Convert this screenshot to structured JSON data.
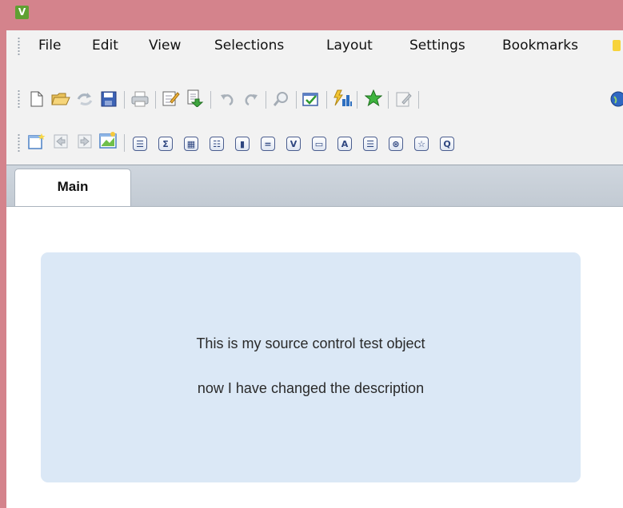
{
  "app": {
    "icon_letter": "V"
  },
  "colors": {
    "titlebar": "#d4838c",
    "app_icon": "#5fa032",
    "toolbar_bg": "#f2f2f2",
    "text_object_bg": "#dbe8f6"
  },
  "menu": {
    "items": [
      "File",
      "Edit",
      "View",
      "Selections",
      "Layout",
      "Settings",
      "Bookmarks"
    ]
  },
  "toolbar1": {
    "icons": [
      "new-document-icon",
      "open-folder-icon",
      "reload-icon",
      "save-icon",
      "print-icon",
      "edit-script-icon",
      "reload-data-icon",
      "undo-icon",
      "redo-icon",
      "search-icon",
      "select-fields-icon",
      "chart-wizard-icon",
      "bookmark-star-icon",
      "edit-module-icon",
      "help-globe-icon"
    ]
  },
  "toolbar2": {
    "icons": [
      "new-sheet-icon",
      "promote-sheet-icon",
      "demote-sheet-icon",
      "sheet-properties-icon",
      "listbox-icon",
      "statistics-box-icon",
      "table-box-icon",
      "multi-box-icon",
      "chart-icon",
      "input-box-icon",
      "current-selections-icon",
      "button-icon",
      "text-object-icon",
      "line-arrow-icon",
      "slider-icon",
      "bookmark-object-icon",
      "search-object-icon"
    ],
    "glyphs": [
      "☰",
      "Σ",
      "▦",
      "☷",
      "▮",
      "=",
      "V",
      "▭",
      "A",
      "☰",
      "⊛",
      "☆",
      "Q"
    ]
  },
  "tabs": [
    {
      "label": "Main",
      "active": true
    }
  ],
  "text_object": {
    "line1": "This is my source control test object",
    "line2": "now I have changed the description"
  }
}
